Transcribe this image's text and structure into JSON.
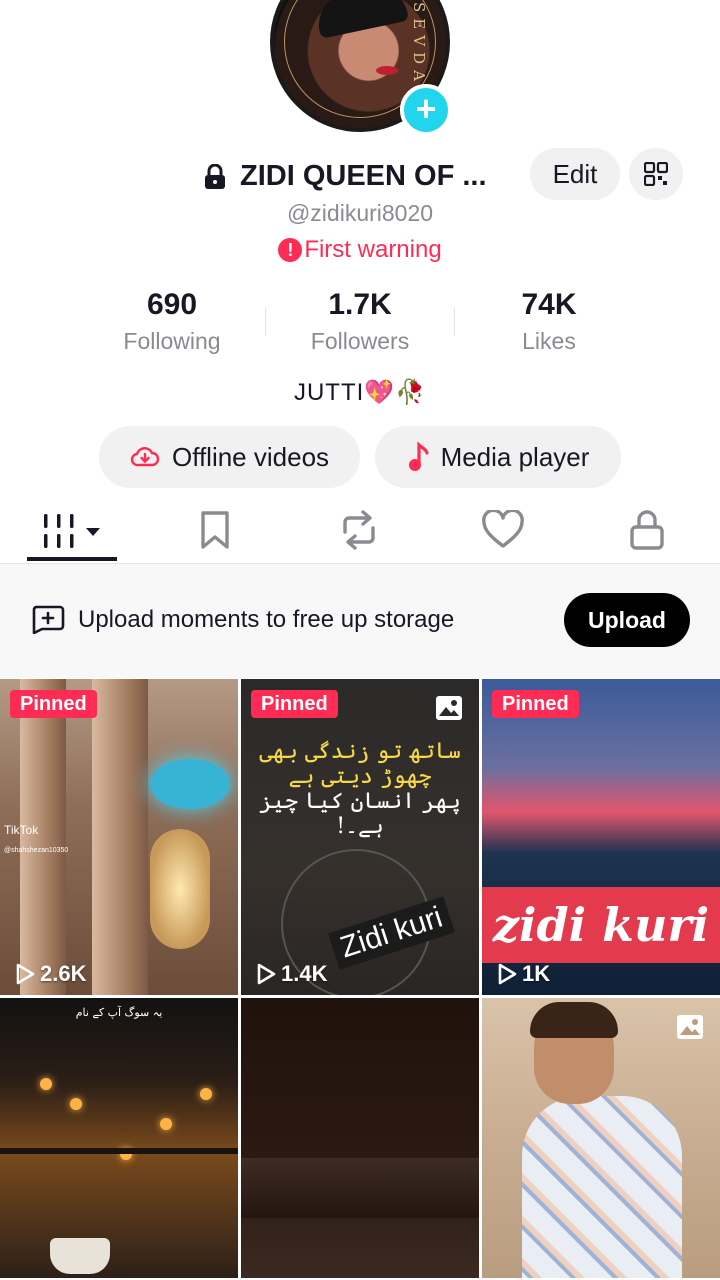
{
  "profile": {
    "avatar_signature": "SEVDA",
    "display_name": "ZIDI QUEEN OF ...",
    "handle": "@zidikuri8020",
    "warning": "First warning",
    "warning_icon": "!",
    "edit_label": "Edit",
    "bio": "JUTTI💖🥀"
  },
  "stats": [
    {
      "value": "690",
      "label": "Following"
    },
    {
      "value": "1.7K",
      "label": "Followers"
    },
    {
      "value": "74K",
      "label": "Likes"
    }
  ],
  "actions": {
    "offline": "Offline videos",
    "media": "Media player"
  },
  "tabs": [
    "videos-grid-icon",
    "bookmark-icon",
    "repost-icon",
    "heart-icon",
    "lock-icon"
  ],
  "upload_banner": {
    "text": "Upload moments to free up storage",
    "button": "Upload"
  },
  "grid": {
    "pinned_label": "Pinned",
    "items": [
      {
        "views": "2.6K",
        "pinned": true,
        "watermark": "TikTok",
        "watermark_user": "@shahshezan10350"
      },
      {
        "views": "1.4K",
        "pinned": true,
        "photo": true,
        "line1": "ساتھ تو زندگی بھی چھوڑ دیتی ہے",
        "line2": "پھر انسان کیا چیز ہے۔!",
        "tag": "Zidi kuri"
      },
      {
        "views": "1K",
        "pinned": true,
        "banner": "zidi kuri"
      },
      {
        "caption": "یہ سوگ آپ کے نام"
      },
      {},
      {
        "photo": true
      }
    ]
  },
  "colors": {
    "accent": "#fe2c55",
    "add_button": "#20d5ec",
    "pill_bg": "#f1f1f2"
  }
}
